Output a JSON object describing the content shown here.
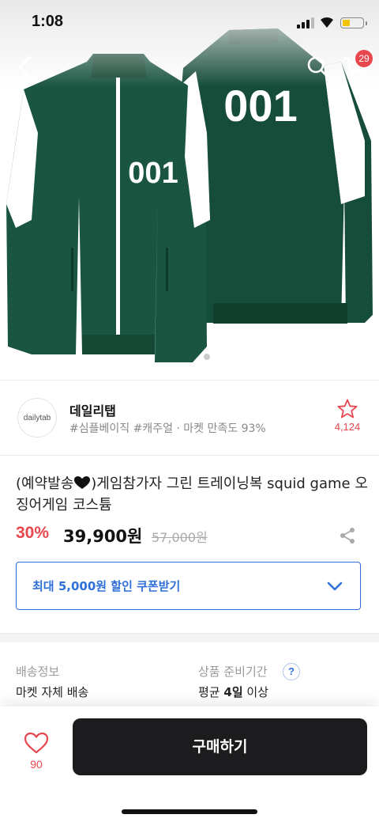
{
  "status_bar": {
    "time": "1:08"
  },
  "nav": {
    "cart_count": "29",
    "back_icon": "chevron-left-icon",
    "search_icon": "search-icon",
    "cart_icon": "cart-icon"
  },
  "hero": {
    "front_number": "001",
    "back_number": "001",
    "jacket_color": "#164c3a"
  },
  "seller": {
    "logo_text": "dailytab",
    "name": "데일리탭",
    "tags": "#심플베이직 #캐주얼 · 마켓 만족도 93%",
    "favorite_count": "4,124"
  },
  "product": {
    "title_before": "(예약발송",
    "title_after": ")게임참가자 그린 트레이닝복 squid game 오징어게임 코스튬",
    "discount": "30%",
    "price": "39,900원",
    "original_price": "57,000원"
  },
  "coupon": {
    "label": "최대 5,000원 할인 쿠폰받기"
  },
  "shipping": {
    "label": "배송정보",
    "value": "마켓 자체 배송",
    "prep_label": "상품 준비기간",
    "help": "?",
    "prep_prefix": "평균",
    "prep_days": "4일",
    "prep_suffix": "이상"
  },
  "bottom": {
    "like_count": "90",
    "buy_label": "구매하기"
  },
  "colors": {
    "accent": "#e8464e",
    "link": "#2f6fd8",
    "button": "#1c1c1e"
  }
}
